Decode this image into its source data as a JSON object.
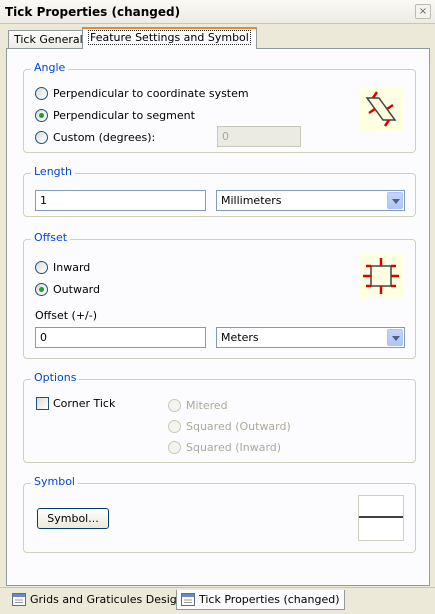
{
  "window": {
    "title": "Tick Properties (changed)",
    "close_glyph": "×"
  },
  "tabs": [
    {
      "label": "Tick General",
      "active": false
    },
    {
      "label": "Feature Settings and Symbol",
      "active": true
    }
  ],
  "angle": {
    "legend": "Angle",
    "options": [
      {
        "label": "Perpendicular to coordinate system",
        "checked": false
      },
      {
        "label": "Perpendicular to segment",
        "checked": true
      },
      {
        "label": "Custom (degrees):",
        "checked": false
      }
    ],
    "custom_value": "0"
  },
  "length": {
    "legend": "Length",
    "value": "1",
    "unit": "Millimeters"
  },
  "offset": {
    "legend": "Offset",
    "options": [
      {
        "label": "Inward",
        "checked": false
      },
      {
        "label": "Outward",
        "checked": true
      }
    ],
    "offset_label": "Offset (+/-)",
    "value": "0",
    "unit": "Meters"
  },
  "options": {
    "legend": "Options",
    "corner_tick_label": "Corner Tick",
    "corner_tick_checked": false,
    "style_options": [
      "Mitered",
      "Squared (Outward)",
      "Squared (Inward)"
    ]
  },
  "symbol": {
    "legend": "Symbol",
    "button_label": "Symbol..."
  },
  "bottom_tabs": [
    {
      "label": "Grids and Graticules Designer",
      "icon": "window-icon",
      "active": false
    },
    {
      "label": "Tick Properties (changed)",
      "icon": "window-icon",
      "active": true
    }
  ],
  "colors": {
    "accent_tick": "#e00000",
    "legend_blue": "#0046d5",
    "active_tab_border": "#e68b2c"
  }
}
